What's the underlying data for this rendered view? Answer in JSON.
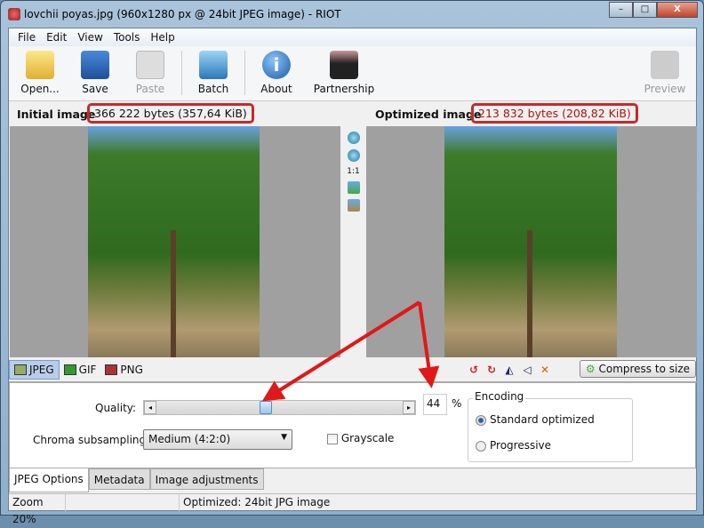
{
  "window": {
    "title": "lovchii poyas.jpg (960x1280 px @ 24bit JPEG image) - RIOT",
    "minimize": "–",
    "maximize": "□",
    "close": "X"
  },
  "menu": [
    "File",
    "Edit",
    "View",
    "Tools",
    "Help"
  ],
  "toolbar": {
    "open": "Open...",
    "save": "Save",
    "paste": "Paste",
    "batch": "Batch",
    "about": "About",
    "partnership": "Partnership",
    "preview": "Preview"
  },
  "header": {
    "initial_label": "Initial image",
    "initial_size": "366 222 bytes (357,64 KiB)",
    "optimized_label": "Optimized image",
    "optimized_size": "213 832 bytes (208,82 KiB)"
  },
  "zoom_tools": {
    "one_to_one": "1:1"
  },
  "formats": {
    "jpeg": "JPEG",
    "gif": "GIF",
    "png": "PNG",
    "compress": "Compress to size"
  },
  "jpeg_options": {
    "quality_label": "Quality:",
    "quality_value": "44",
    "quality_percent": 44,
    "percent_sign": "%",
    "chroma_label": "Chroma subsampling:",
    "chroma_value": "Medium (4:2:0)",
    "grayscale": "Grayscale",
    "encoding_label": "Encoding",
    "standard": "Standard optimized",
    "progressive": "Progressive",
    "encoding_selected": "Standard optimized"
  },
  "bottom_tabs": [
    "JPEG Options",
    "Metadata",
    "Image adjustments"
  ],
  "status": {
    "zoom": "Zoom 20%",
    "info": "Optimized: 24bit JPG image"
  },
  "colors": {
    "annotation": "#c92828",
    "accent": "#2a5da8"
  }
}
